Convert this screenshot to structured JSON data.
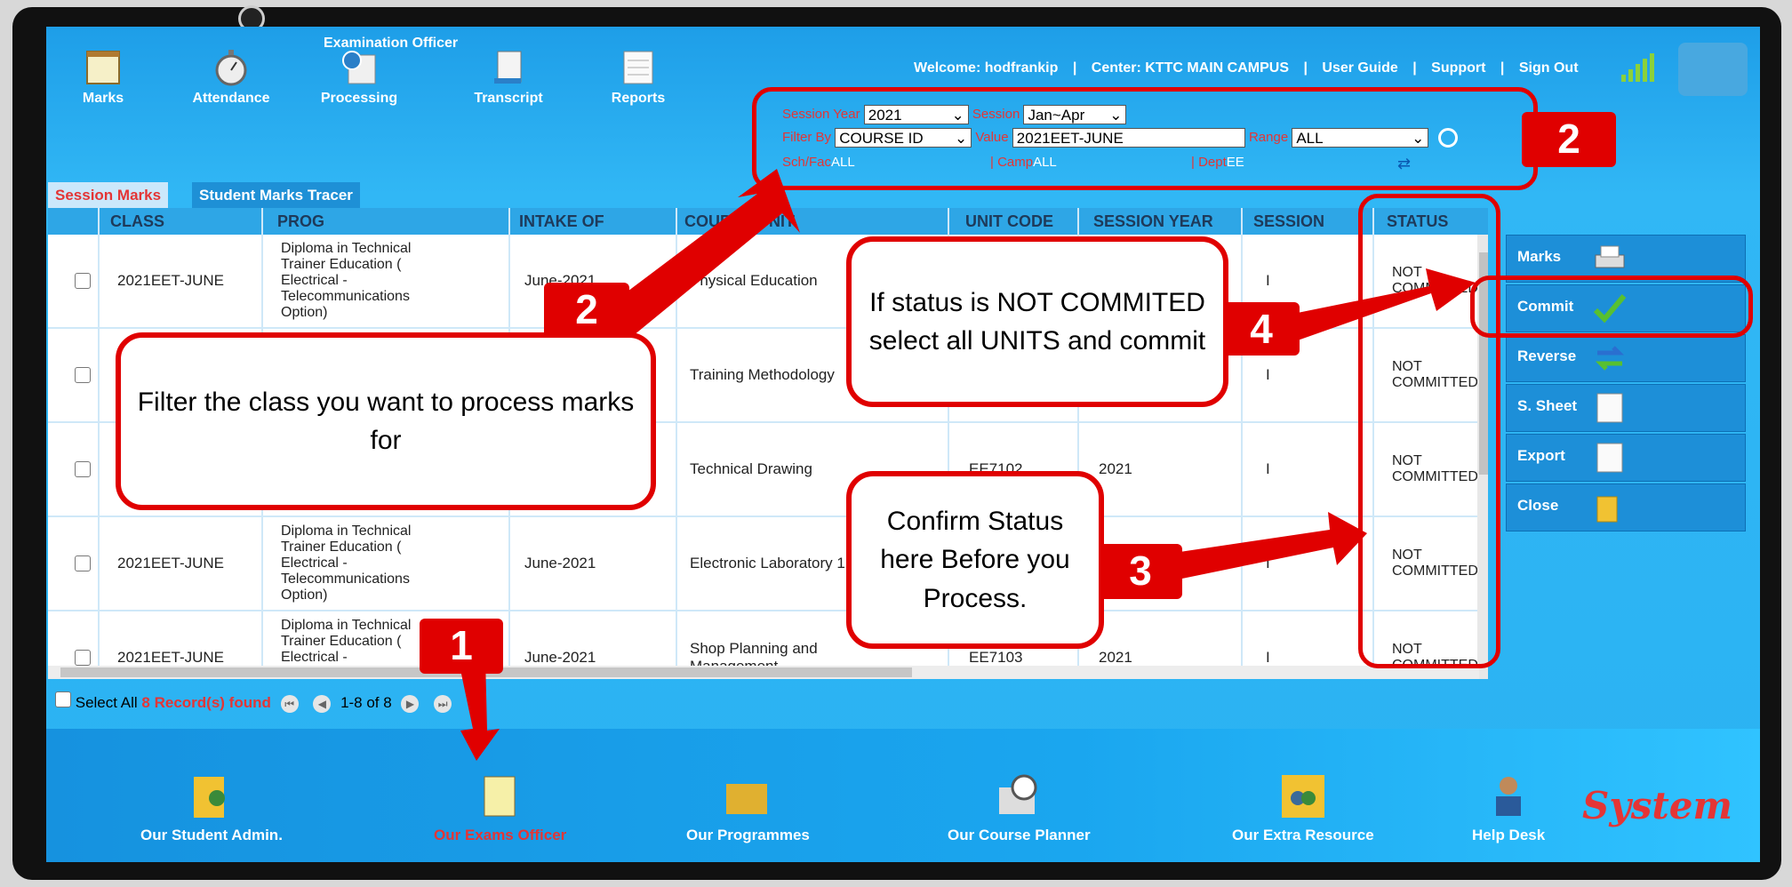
{
  "app": {
    "role_title": "Examination Officer",
    "top_nav": [
      "Marks",
      "Attendance",
      "Processing",
      "Transcript",
      "Reports"
    ],
    "top_links": [
      "Welcome: hodfrankip",
      "|",
      "Center: KTTC MAIN CAMPUS",
      "|",
      "User Guide",
      "|",
      "Support",
      "|",
      "Sign Out"
    ]
  },
  "filter": {
    "session_year_label": "Session Year",
    "session_year": "2021",
    "session_label": "Session",
    "session": "Jan~Apr",
    "filter_by_label": "Filter By",
    "filter_by": "COURSE ID",
    "value_label": "Value",
    "value": "2021EET-JUNE",
    "range_label": "Range",
    "range": "ALL",
    "schfac_label": "Sch/Fac",
    "schfac": "ALL",
    "camp_label": "| Camp",
    "camp": "ALL",
    "dept_label": "| Dept",
    "dept": "EE"
  },
  "tabs": [
    "Session Marks",
    "Student Marks Tracer"
  ],
  "table": {
    "headers": [
      "CLASS",
      "PROG",
      "INTAKE OF",
      "COURSE UNIT",
      "UNIT CODE",
      "SESSION YEAR",
      "SESSION",
      "STATUS"
    ],
    "rows": [
      {
        "class": "2021EET-JUNE",
        "prog": "Diploma in Technical Trainer Education ( Electrical - Telecommunications Option)",
        "intake": "June-2021",
        "unit": "Physical Education",
        "code": "",
        "year": "",
        "session": "I",
        "status": "NOT COMMITTED"
      },
      {
        "class": "",
        "prog": "",
        "intake": "",
        "unit": "Training Methodology",
        "code": "",
        "year": "",
        "session": "I",
        "status": "NOT COMMITTED"
      },
      {
        "class": "",
        "prog": "",
        "intake": "",
        "unit": "Technical Drawing",
        "code": "EE7102",
        "year": "2021",
        "session": "I",
        "status": "NOT COMMITTED"
      },
      {
        "class": "2021EET-JUNE",
        "prog": "Diploma in Technical Trainer Education ( Electrical - Telecommunications Option)",
        "intake": "June-2021",
        "unit": "Electronic Laboratory 1",
        "code": "",
        "year": "",
        "session": "I",
        "status": "NOT COMMITTED"
      },
      {
        "class": "2021EET-JUNE",
        "prog": "Diploma in Technical Trainer Education ( Electrical - Telecommunications Option)",
        "intake": "June-2021",
        "unit": "Shop Planning and Management",
        "code": "EE7103",
        "year": "2021",
        "session": "I",
        "status": "NOT COMMITTED"
      }
    ]
  },
  "pager": {
    "select_all": "Select All",
    "records": "8 Record(s) found",
    "range": "1-8 of 8"
  },
  "side_buttons": [
    "Marks",
    "Commit",
    "Reverse",
    "S. Sheet",
    "Export",
    "Close"
  ],
  "bottom_nav": [
    "Our Student Admin.",
    "Our Exams Officer",
    "Our Programmes",
    "Our Course Planner",
    "Our Extra Resource",
    "Help Desk"
  ],
  "brand": "System",
  "annotations": {
    "callout_filter": "Filter the class you want to process marks for",
    "callout_commit": "If status is NOT COMMITED select all UNITS and commit",
    "callout_confirm": "Confirm Status here Before you Process.",
    "n1": "1",
    "n2": "2",
    "n3": "3",
    "n4": "4"
  },
  "colors": {
    "accent_red": "#e00000",
    "screen_blue": "#2ab2f2",
    "header_blue": "#2ea6e6"
  }
}
